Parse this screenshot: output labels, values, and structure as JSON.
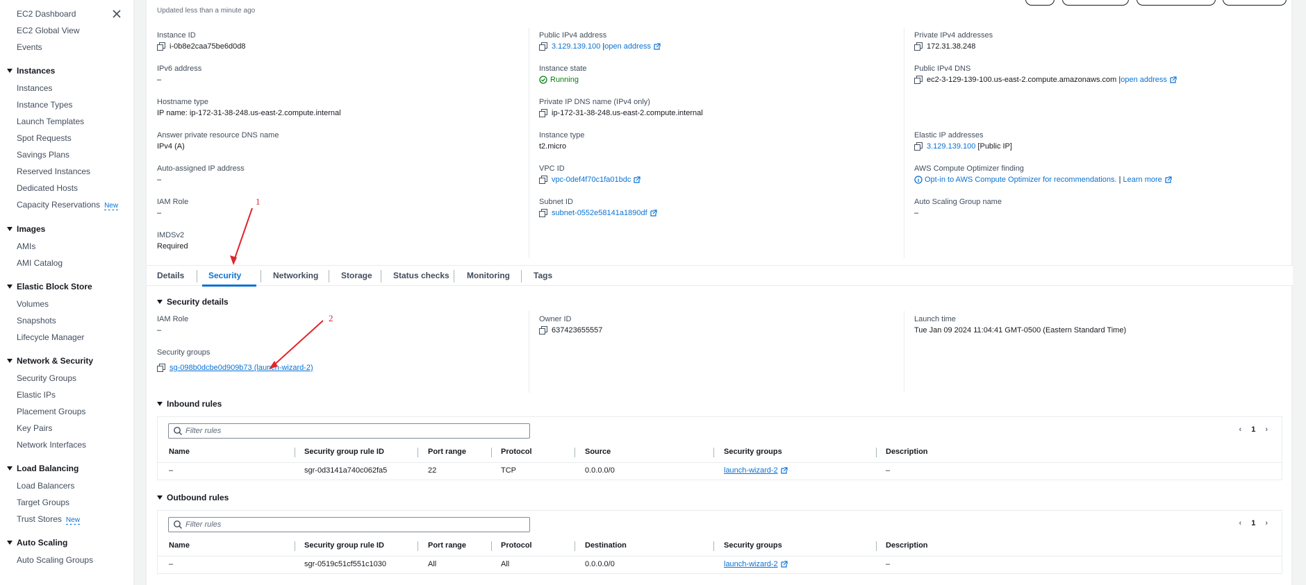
{
  "sidebar": {
    "top_items": [
      "EC2 Dashboard",
      "EC2 Global View",
      "Events"
    ],
    "sections": [
      {
        "title": "Instances",
        "items": [
          "Instances",
          "Instance Types",
          "Launch Templates",
          "Spot Requests",
          "Savings Plans",
          "Reserved Instances",
          "Dedicated Hosts",
          "Capacity Reservations"
        ]
      },
      {
        "title": "Images",
        "items": [
          "AMIs",
          "AMI Catalog"
        ]
      },
      {
        "title": "Elastic Block Store",
        "items": [
          "Volumes",
          "Snapshots",
          "Lifecycle Manager"
        ]
      },
      {
        "title": "Network & Security",
        "items": [
          "Security Groups",
          "Elastic IPs",
          "Placement Groups",
          "Key Pairs",
          "Network Interfaces"
        ]
      },
      {
        "title": "Load Balancing",
        "items": [
          "Load Balancers",
          "Target Groups",
          "Trust Stores"
        ]
      },
      {
        "title": "Auto Scaling",
        "items": [
          "Auto Scaling Groups"
        ]
      }
    ],
    "new_badge": "New"
  },
  "summary": {
    "updated": "Updated less than a minute ago",
    "instance_id_label": "Instance ID",
    "instance_id": "i-0b8e2caa75be6d0d8",
    "ipv6_label": "IPv6 address",
    "ipv6": "–",
    "hostname_type_label": "Hostname type",
    "hostname_type": "IP name: ip-172-31-38-248.us-east-2.compute.internal",
    "answer_dns_label": "Answer private resource DNS name",
    "answer_dns": "IPv4 (A)",
    "auto_ip_label": "Auto-assigned IP address",
    "auto_ip": "–",
    "iam_role_label": "IAM Role",
    "iam_role": "–",
    "imdsv2_label": "IMDSv2",
    "imdsv2": "Required",
    "public_ipv4_label": "Public IPv4 address",
    "public_ipv4": "3.129.139.100",
    "open_address": "open address",
    "instance_state_label": "Instance state",
    "instance_state": "Running",
    "private_dns_label": "Private IP DNS name (IPv4 only)",
    "private_dns": "ip-172-31-38-248.us-east-2.compute.internal",
    "instance_type_label": "Instance type",
    "instance_type": "t2.micro",
    "vpc_id_label": "VPC ID",
    "vpc_id": "vpc-0def4f70c1fa01bdc",
    "subnet_id_label": "Subnet ID",
    "subnet_id": "subnet-0552e58141a1890df",
    "private_ipv4_label": "Private IPv4 addresses",
    "private_ipv4": "172.31.38.248",
    "public_dns_label": "Public IPv4 DNS",
    "public_dns": "ec2-3-129-139-100.us-east-2.compute.amazonaws.com",
    "elastic_ip_label": "Elastic IP addresses",
    "elastic_ip": "3.129.139.100",
    "elastic_ip_suffix": "[Public IP]",
    "optimizer_label": "AWS Compute Optimizer finding",
    "optimizer": "Opt-in to AWS Compute Optimizer for recommendations.",
    "learn_more": "Learn more",
    "asg_label": "Auto Scaling Group name",
    "asg": "–"
  },
  "tabs": [
    "Details",
    "Security",
    "Networking",
    "Storage",
    "Status checks",
    "Monitoring",
    "Tags"
  ],
  "security": {
    "heading": "Security details",
    "iam_role_label": "IAM Role",
    "iam_role": "–",
    "sg_label": "Security groups",
    "sg": "sg-098b0dcbe0d909b73 (launch-wizard-2)",
    "owner_label": "Owner ID",
    "owner": "637423655557",
    "launch_label": "Launch time",
    "launch": "Tue Jan 09 2024 11:04:41 GMT-0500 (Eastern Standard Time)"
  },
  "inbound": {
    "heading": "Inbound rules",
    "placeholder": "Filter rules",
    "page": "1",
    "columns": [
      "Name",
      "Security group rule ID",
      "Port range",
      "Protocol",
      "Source",
      "Security groups",
      "Description"
    ],
    "row": [
      "–",
      "sgr-0d3141a740c062fa5",
      "22",
      "TCP",
      "0.0.0.0/0",
      "launch-wizard-2",
      "–"
    ]
  },
  "outbound": {
    "heading": "Outbound rules",
    "placeholder": "Filter rules",
    "page": "1",
    "columns": [
      "Name",
      "Security group rule ID",
      "Port range",
      "Protocol",
      "Destination",
      "Security groups",
      "Description"
    ],
    "row": [
      "–",
      "sgr-0519c51cf551c1030",
      "All",
      "All",
      "0.0.0.0/0",
      "launch-wizard-2",
      "–"
    ]
  },
  "annotations": [
    "1",
    "2"
  ]
}
